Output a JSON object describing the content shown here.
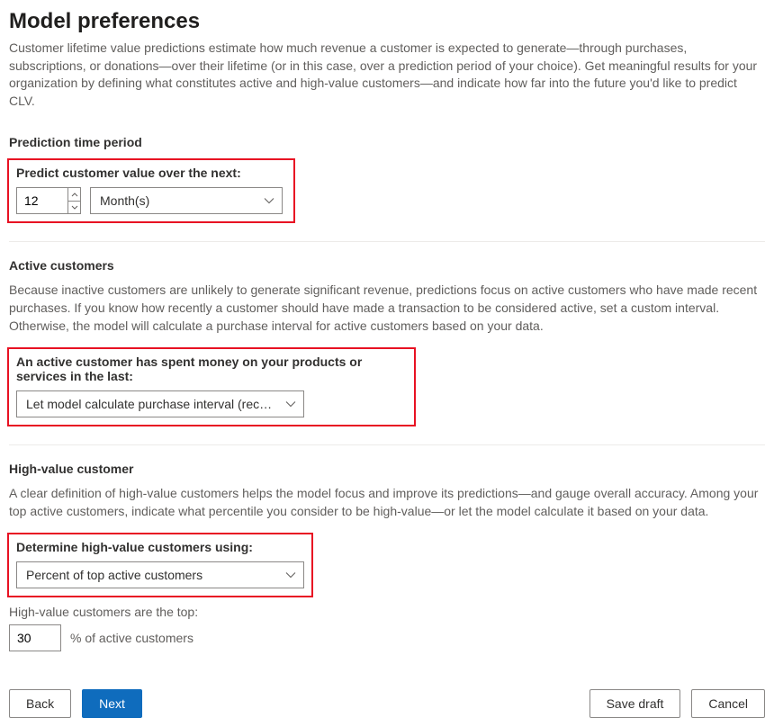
{
  "header": {
    "title": "Model preferences",
    "description": "Customer lifetime value predictions estimate how much revenue a customer is expected to generate—through purchases, subscriptions, or donations—over their lifetime (or in this case, over a prediction period of your choice). Get meaningful results for your organization by defining what constitutes active and high-value customers—and indicate how far into the future you'd like to predict CLV."
  },
  "prediction": {
    "section_title": "Prediction time period",
    "field_label": "Predict customer value over the next:",
    "value": "12",
    "unit": "Month(s)"
  },
  "active": {
    "section_title": "Active customers",
    "description": "Because inactive customers are unlikely to generate significant revenue, predictions focus on active customers who have made recent purchases. If you know how recently a customer should have made a transaction to be considered active, set a custom interval. Otherwise, the model will calculate a purchase interval for active customers based on your data.",
    "field_label": "An active customer has spent money on your products or services in the last:",
    "value": "Let model calculate purchase interval (recommend…"
  },
  "highvalue": {
    "section_title": "High-value customer",
    "description": "A clear definition of high-value customers helps the model focus and improve its predictions—and gauge overall accuracy. Among your top active customers, indicate what percentile you consider to be high-value—or let the model calculate it based on your data.",
    "field_label": "Determine high-value customers using:",
    "value": "Percent of top active customers",
    "percent_label": "High-value customers are the top:",
    "percent_value": "30",
    "percent_suffix": "%  of active customers"
  },
  "footer": {
    "back": "Back",
    "next": "Next",
    "save_draft": "Save draft",
    "cancel": "Cancel"
  }
}
